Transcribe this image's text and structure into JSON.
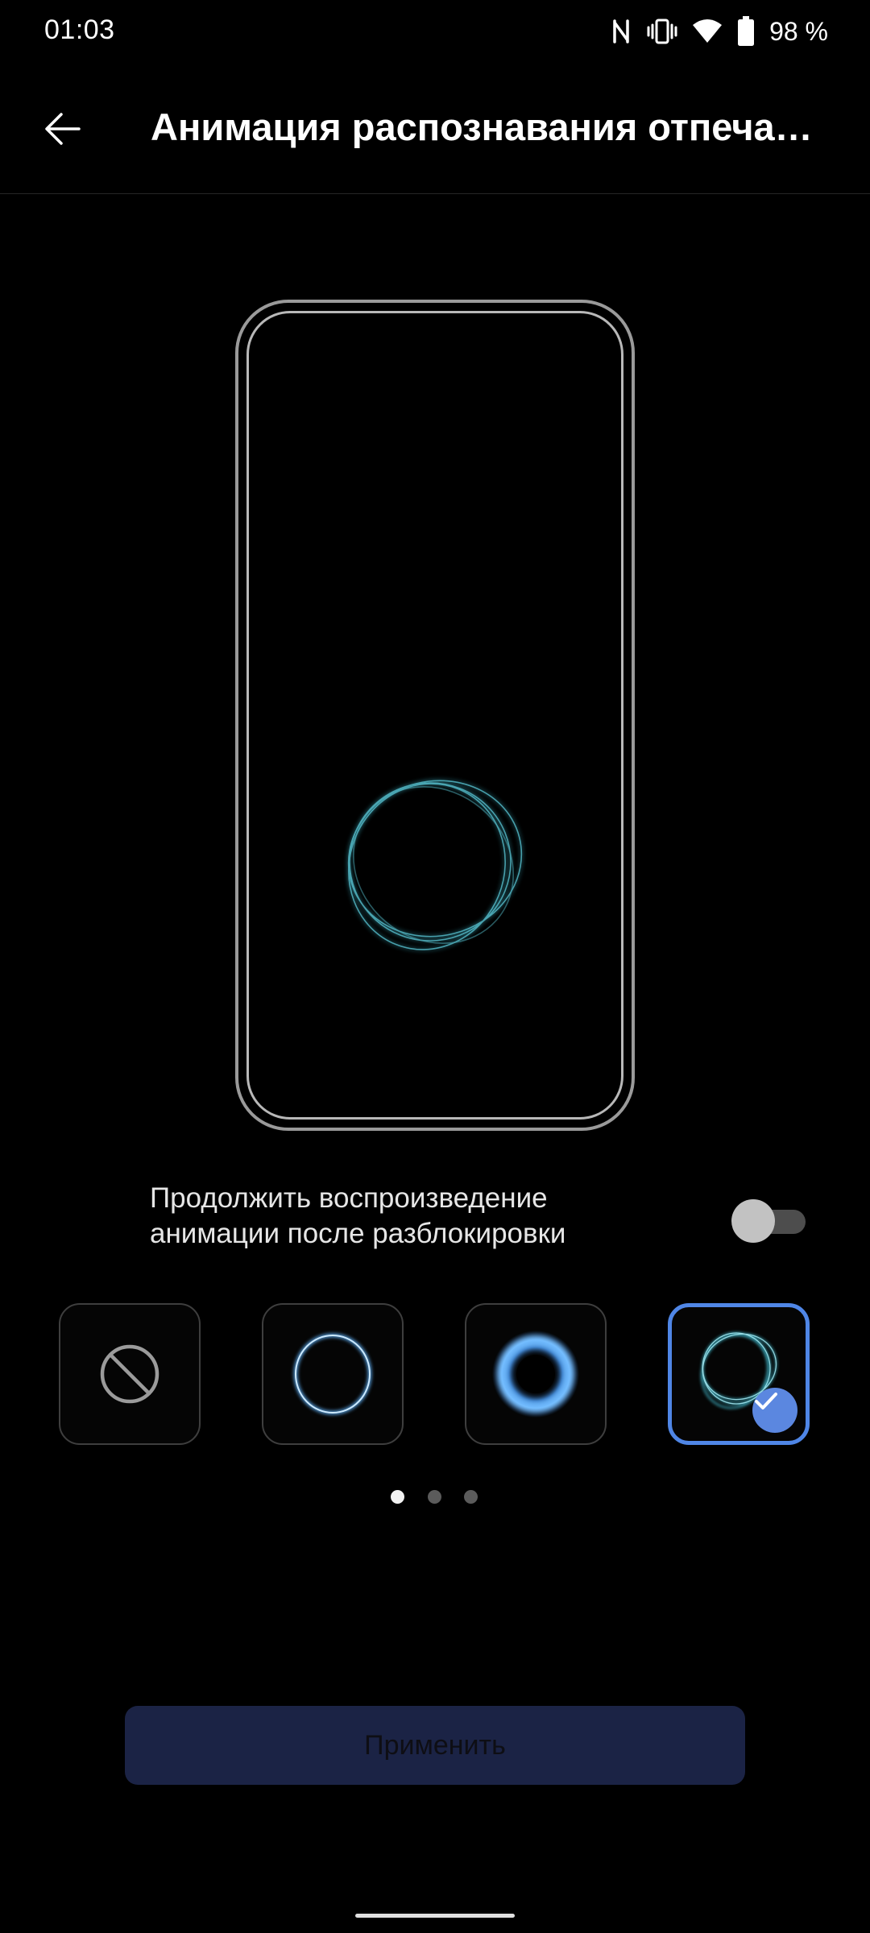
{
  "status_bar": {
    "time": "01:03",
    "battery": "98 %",
    "icons": [
      "nfc-icon",
      "vibrate-icon",
      "wifi-icon",
      "battery-icon"
    ]
  },
  "app_bar": {
    "title": "Анимация распознавания отпечатка пальца",
    "back_icon": "arrow-left-icon"
  },
  "preview": {
    "animation": "wave-ring-animation"
  },
  "toggle": {
    "label": "Продолжить воспроизведение анимации после разблокировки",
    "checked": false
  },
  "options": [
    {
      "name": "none",
      "icon": "prohibited-icon",
      "selected": false
    },
    {
      "name": "thin-ring",
      "icon": "thin-ring-icon",
      "selected": false
    },
    {
      "name": "glow-ring",
      "icon": "glow-ring-icon",
      "selected": false
    },
    {
      "name": "wave-ring",
      "icon": "wave-ring-icon",
      "selected": true
    }
  ],
  "pagination": {
    "pages": 3,
    "current": 1
  },
  "apply_button": {
    "label": "Применить"
  },
  "colors": {
    "background": "#000000",
    "accent": "#4f86e6",
    "check_badge": "#5b87e0",
    "apply_button_bg": "#1b2345",
    "ring_cyan": "#3fb6c9",
    "ring_blue": "#5aa6e8"
  }
}
